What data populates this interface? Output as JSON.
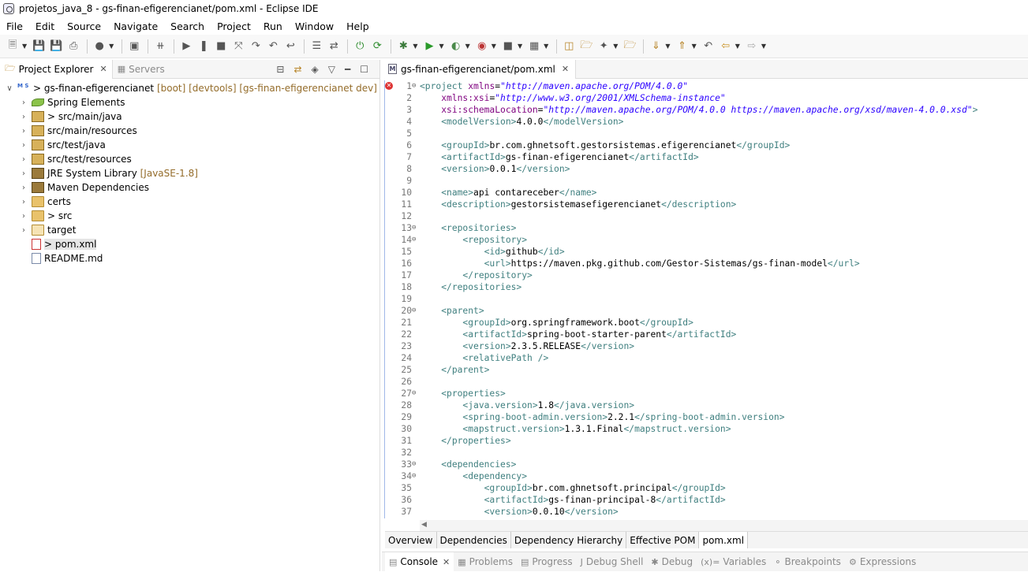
{
  "window": {
    "title": "projetos_java_8 - gs-finan-efigerencianet/pom.xml - Eclipse IDE"
  },
  "menu": [
    "File",
    "Edit",
    "Source",
    "Navigate",
    "Search",
    "Project",
    "Run",
    "Window",
    "Help"
  ],
  "left_panel": {
    "tabs": [
      {
        "label": "Project Explorer",
        "active": true
      },
      {
        "label": "Servers",
        "active": false
      }
    ],
    "tree": [
      {
        "label": "> gs-finan-efigerencianet",
        "meta": "[boot] [devtools] [gs-finan-efigerencianet dev]",
        "icon": "project-icon",
        "expanded": true
      },
      {
        "label": "Spring Elements",
        "meta": "",
        "icon": "spring-leaf-icon"
      },
      {
        "label": "> src/main/java",
        "meta": "",
        "icon": "source-folder-icon"
      },
      {
        "label": "src/main/resources",
        "meta": "",
        "icon": "source-folder-icon"
      },
      {
        "label": "src/test/java",
        "meta": "",
        "icon": "source-folder-icon"
      },
      {
        "label": "src/test/resources",
        "meta": "",
        "icon": "source-folder-icon"
      },
      {
        "label": "JRE System Library",
        "meta": "[JavaSE-1.8]",
        "icon": "library-icon"
      },
      {
        "label": "Maven Dependencies",
        "meta": "",
        "icon": "library-icon"
      },
      {
        "label": "certs",
        "meta": "",
        "icon": "folder-icon"
      },
      {
        "label": "> src",
        "meta": "",
        "icon": "folder-icon"
      },
      {
        "label": "target",
        "meta": "",
        "icon": "folder-icon"
      },
      {
        "label": "> pom.xml",
        "meta": "",
        "icon": "xml-file-icon"
      },
      {
        "label": "README.md",
        "meta": "",
        "icon": "markdown-file-icon"
      }
    ]
  },
  "editor": {
    "tab_label": "gs-finan-efigerencianet/pom.xml",
    "code_lines": [
      {
        "n": "1",
        "fold": "⊖",
        "html": "<span class='tag'>&lt;project</span> <span class='attr'>xmlns</span>=<span class='val'>\"http://maven.apache.org/POM/4.0.0\"</span>"
      },
      {
        "n": "2",
        "fold": "",
        "html": "    <span class='attr'>xmlns:xsi</span>=<span class='val'>\"http://www.w3.org/2001/XMLSchema-instance\"</span>"
      },
      {
        "n": "3",
        "fold": "",
        "html": "    <span class='attr'>xsi:schemaLocation</span>=<span class='val'>\"http://maven.apache.org/POM/4.0.0 https://maven.apache.org/xsd/maven-4.0.0.xsd\"</span><span class='tag'>&gt;</span>"
      },
      {
        "n": "4",
        "fold": "",
        "html": "    <span class='tag'>&lt;modelVersion&gt;</span>4.0.0<span class='tag'>&lt;/modelVersion&gt;</span>"
      },
      {
        "n": "5",
        "fold": "",
        "html": ""
      },
      {
        "n": "6",
        "fold": "",
        "html": "    <span class='tag'>&lt;groupId&gt;</span>br.com.ghnetsoft.gestorsistemas.efigerencianet<span class='tag'>&lt;/groupId&gt;</span>"
      },
      {
        "n": "7",
        "fold": "",
        "html": "    <span class='tag'>&lt;artifactId&gt;</span>gs-finan-efigerencianet<span class='tag'>&lt;/artifactId&gt;</span>"
      },
      {
        "n": "8",
        "fold": "",
        "html": "    <span class='tag'>&lt;version&gt;</span>0.0.1<span class='tag'>&lt;/version&gt;</span>"
      },
      {
        "n": "9",
        "fold": "",
        "html": ""
      },
      {
        "n": "10",
        "fold": "",
        "html": "    <span class='tag'>&lt;name&gt;</span>api contareceber<span class='tag'>&lt;/name&gt;</span>"
      },
      {
        "n": "11",
        "fold": "",
        "html": "    <span class='tag'>&lt;description&gt;</span>gestorsistemasefigerencianet<span class='tag'>&lt;/description&gt;</span>"
      },
      {
        "n": "12",
        "fold": "",
        "html": ""
      },
      {
        "n": "13",
        "fold": "⊖",
        "html": "    <span class='tag'>&lt;repositories&gt;</span>"
      },
      {
        "n": "14",
        "fold": "⊖",
        "html": "        <span class='tag'>&lt;repository&gt;</span>"
      },
      {
        "n": "15",
        "fold": "",
        "html": "            <span class='tag'>&lt;id&gt;</span>github<span class='tag'>&lt;/id&gt;</span>"
      },
      {
        "n": "16",
        "fold": "",
        "html": "            <span class='tag'>&lt;url&gt;</span>https://maven.pkg.github.com/Gestor-Sistemas/gs-finan-model<span class='tag'>&lt;/url&gt;</span>"
      },
      {
        "n": "17",
        "fold": "",
        "html": "        <span class='tag'>&lt;/repository&gt;</span>"
      },
      {
        "n": "18",
        "fold": "",
        "html": "    <span class='tag'>&lt;/repositories&gt;</span>"
      },
      {
        "n": "19",
        "fold": "",
        "html": ""
      },
      {
        "n": "20",
        "fold": "⊖",
        "html": "    <span class='tag'>&lt;parent&gt;</span>"
      },
      {
        "n": "21",
        "fold": "",
        "html": "        <span class='tag'>&lt;groupId&gt;</span>org.springframework.boot<span class='tag'>&lt;/groupId&gt;</span>"
      },
      {
        "n": "22",
        "fold": "",
        "html": "        <span class='tag'>&lt;artifactId&gt;</span>spring-boot-starter-parent<span class='tag'>&lt;/artifactId&gt;</span>"
      },
      {
        "n": "23",
        "fold": "",
        "html": "        <span class='tag'>&lt;version&gt;</span>2.3.5.RELEASE<span class='tag'>&lt;/version&gt;</span>"
      },
      {
        "n": "24",
        "fold": "",
        "html": "        <span class='tag'>&lt;relativePath /&gt;</span>"
      },
      {
        "n": "25",
        "fold": "",
        "html": "    <span class='tag'>&lt;/parent&gt;</span>"
      },
      {
        "n": "26",
        "fold": "",
        "html": ""
      },
      {
        "n": "27",
        "fold": "⊖",
        "html": "    <span class='tag'>&lt;properties&gt;</span>"
      },
      {
        "n": "28",
        "fold": "",
        "html": "        <span class='tag'>&lt;java.version&gt;</span>1.8<span class='tag'>&lt;/java.version&gt;</span>"
      },
      {
        "n": "29",
        "fold": "",
        "html": "        <span class='tag'>&lt;spring-boot-admin.version&gt;</span>2.2.1<span class='tag'>&lt;/spring-boot-admin.version&gt;</span>"
      },
      {
        "n": "30",
        "fold": "",
        "html": "        <span class='tag'>&lt;mapstruct.version&gt;</span>1.3.1.Final<span class='tag'>&lt;/mapstruct.version&gt;</span>"
      },
      {
        "n": "31",
        "fold": "",
        "html": "    <span class='tag'>&lt;/properties&gt;</span>"
      },
      {
        "n": "32",
        "fold": "",
        "html": ""
      },
      {
        "n": "33",
        "fold": "⊖",
        "html": "    <span class='tag'>&lt;dependencies&gt;</span>"
      },
      {
        "n": "34",
        "fold": "⊖",
        "html": "        <span class='tag'>&lt;dependency&gt;</span>"
      },
      {
        "n": "35",
        "fold": "",
        "html": "            <span class='tag'>&lt;groupId&gt;</span>br.com.ghnetsoft.principal<span class='tag'>&lt;/groupId&gt;</span>"
      },
      {
        "n": "36",
        "fold": "",
        "html": "            <span class='tag'>&lt;artifactId&gt;</span>gs-finan-principal-8<span class='tag'>&lt;/artifactId&gt;</span>"
      },
      {
        "n": "37",
        "fold": "",
        "html": "            <span class='tag'>&lt;version&gt;</span>0.0.10<span class='tag'>&lt;/version&gt;</span>"
      }
    ],
    "bottom_tabs": [
      {
        "label": "Overview",
        "active": false
      },
      {
        "label": "Dependencies",
        "active": false
      },
      {
        "label": "Dependency Hierarchy",
        "active": false
      },
      {
        "label": "Effective POM",
        "active": false
      },
      {
        "label": "pom.xml",
        "active": true
      }
    ]
  },
  "bottom_view": {
    "tabs": [
      {
        "label": "Console",
        "active": true,
        "icon": "console-icon"
      },
      {
        "label": "Problems",
        "active": false,
        "icon": "problems-icon"
      },
      {
        "label": "Progress",
        "active": false,
        "icon": "progress-icon"
      },
      {
        "label": "Debug Shell",
        "active": false,
        "icon": "debug-shell-icon"
      },
      {
        "label": "Debug",
        "active": false,
        "icon": "debug-icon"
      },
      {
        "label": "Variables",
        "active": false,
        "icon": "variables-icon",
        "prefix": "(x)="
      },
      {
        "label": "Breakpoints",
        "active": false,
        "icon": "breakpoints-icon"
      },
      {
        "label": "Expressions",
        "active": false,
        "icon": "expressions-icon"
      }
    ]
  },
  "colors": {
    "xml_tag": "#3f7f7f",
    "xml_attr": "#7f007f",
    "xml_value": "#2a00ff",
    "error": "#d33333"
  }
}
